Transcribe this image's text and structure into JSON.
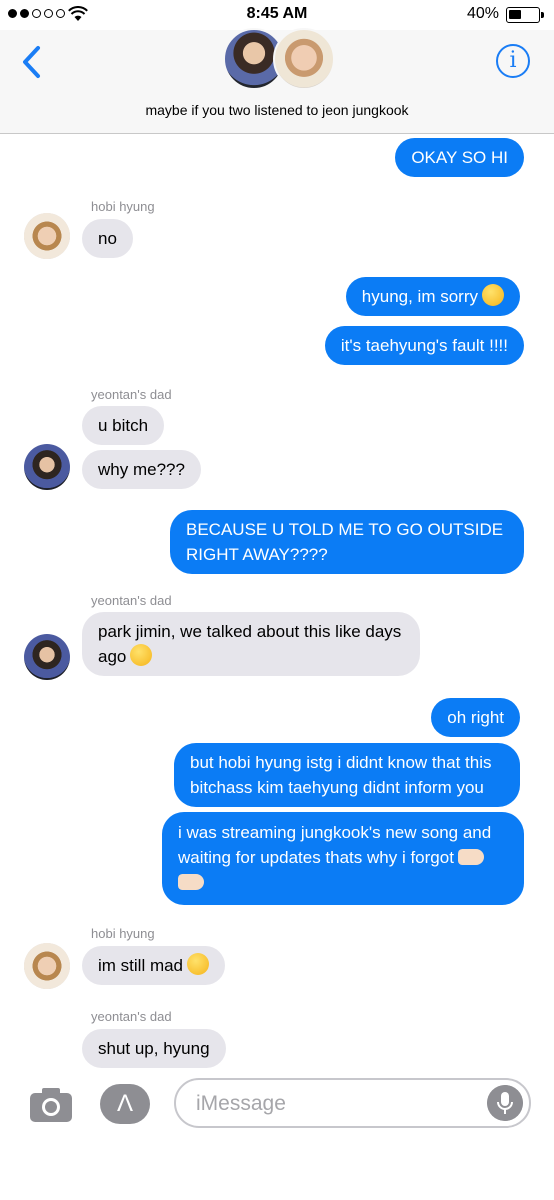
{
  "status_bar": {
    "time": "8:45 AM",
    "battery": "40%"
  },
  "header": {
    "title": "maybe if you two listened to jeon jungkook"
  },
  "messages": {
    "m1": "OKAY SO HI",
    "s1": "hobi hyung",
    "m2": "no",
    "m3": "hyung, im sorry",
    "m4": "it's taehyung's fault !!!!",
    "s2": "yeontan's dad",
    "m5": "u bitch",
    "m6": "why me???",
    "m7a": "BECAUSE U TOLD ME TO GO OUTSIDE",
    "m7b": "RIGHT AWAY????",
    "s3": "yeontan's dad",
    "m8a": "park jimin, we talked about this like days",
    "m8b": "ago",
    "m9": "oh right",
    "m10a": "but hobi hyung istg i didnt know that this",
    "m10b": "bitchass kim taehyung didnt inform you",
    "m11a": "i was streaming jungkook's new song and",
    "m11b": "waiting for updates thats why i forgot",
    "s4": "hobi hyung",
    "m12": "im still mad",
    "s5": "yeontan's dad",
    "m13": "shut up, hyung"
  },
  "emojis": {
    "m3": "pensive-face",
    "m8": "face-with-rolling-eyes",
    "m11": "backhand-index-pointing-left",
    "m12": "thinking-face"
  },
  "input": {
    "placeholder": "iMessage"
  },
  "colors": {
    "accent": "#0b7cf5",
    "incoming": "#e6e5eb"
  }
}
